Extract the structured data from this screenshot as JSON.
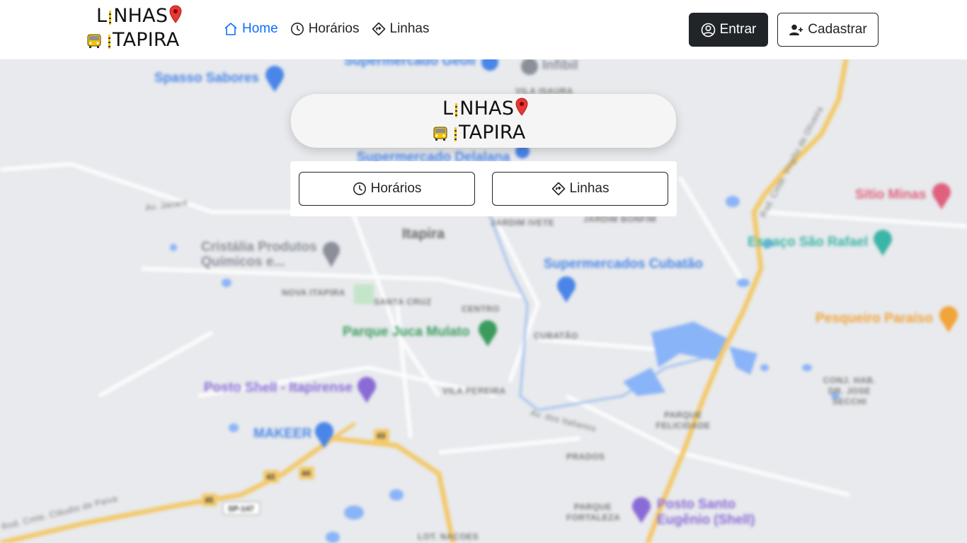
{
  "brand": {
    "line1": "LINHAS",
    "line2": "TAPIRA",
    "line1_first": "L",
    "line1_rest": "NHAS"
  },
  "nav": {
    "items": [
      {
        "label": "Home",
        "icon": "house-icon",
        "active": true
      },
      {
        "label": "Horários",
        "icon": "clock-icon",
        "active": false
      },
      {
        "label": "Linhas",
        "icon": "signpost-icon",
        "active": false
      }
    ]
  },
  "auth": {
    "login_label": "Entrar",
    "signup_label": "Cadastrar"
  },
  "hero": {
    "buttons": [
      {
        "label": "Horários",
        "icon": "clock-icon"
      },
      {
        "label": "Linhas",
        "icon": "signpost-icon"
      }
    ]
  },
  "map": {
    "pois": [
      "Spasso Sabores",
      "Supermercado Geoli",
      "Infibil",
      "Supermercado Delalana",
      "Cristália Produtos Químicos e...",
      "Parque Juca Mulato",
      "Posto Shell - Itapirense",
      "MAKEER",
      "Supermercados Cubatão",
      "Sítio Minas",
      "Espaço São Rafael",
      "Pesqueiro Paraíso",
      "Posto Santo Eugênio (Shell)"
    ],
    "city": "Itapira",
    "areas": [
      "VILA ISAURA",
      "JARDIM IVETE",
      "JARDIM BONFIM",
      "NOVA ITAPIRA",
      "SANTA CRUZ",
      "CENTRO",
      "CUBATÃO",
      "VILA PEREIRA",
      "PARQUE FELICIDADE",
      "PRADOS",
      "PARQUE FORTALEZA",
      "LOT. NACOES",
      "CONJ. HAB. DR. JOSE SECCHI"
    ],
    "roads": [
      "Av. Jacare",
      "Av. dos Italianos",
      "Rod. Cmte. Virgilio de Oliveira",
      "Rod. Cmte. Cláudio de Paiva",
      "SP-147",
      "45",
      "44",
      "43"
    ],
    "colors": {
      "bg": "#e8eaed",
      "highway": "#f3c96b",
      "poi_blue": "#4a86e8",
      "poi_green": "#3a9b5c",
      "poi_pink": "#e0607e",
      "poi_teal": "#3bb5a6",
      "poi_orange": "#f2a339",
      "water": "#8ab4f8"
    }
  },
  "colors": {
    "active_link": "#0d6efd",
    "dark_button": "#212529"
  }
}
